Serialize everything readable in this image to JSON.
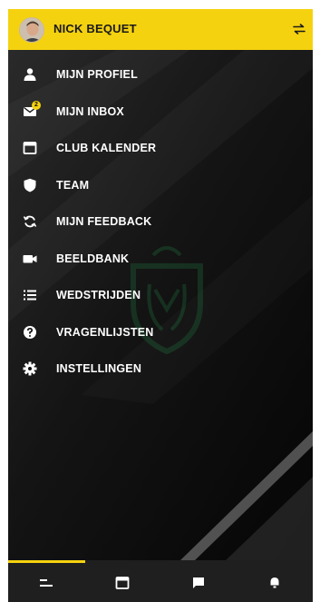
{
  "header": {
    "user_name": "NICK BEQUET",
    "switch_icon": "swap-icon"
  },
  "menu": {
    "items": [
      {
        "label": "MIJN PROFIEL",
        "icon": "person-icon"
      },
      {
        "label": "MIJN INBOX",
        "icon": "mail-icon",
        "badge": "2"
      },
      {
        "label": "CLUB KALENDER",
        "icon": "calendar-icon"
      },
      {
        "label": "TEAM",
        "icon": "shield-icon"
      },
      {
        "label": "MIJN FEEDBACK",
        "icon": "refresh-icon"
      },
      {
        "label": "BEELDBANK",
        "icon": "video-icon"
      },
      {
        "label": "WEDSTRIJDEN",
        "icon": "list-icon"
      },
      {
        "label": "VRAGENLIJSTEN",
        "icon": "question-icon"
      },
      {
        "label": "INSTELLINGEN",
        "icon": "gear-icon"
      }
    ]
  },
  "tabbar": {
    "tabs": [
      {
        "icon": "menu-icon",
        "active": true
      },
      {
        "icon": "calendar-icon",
        "active": false
      },
      {
        "icon": "chat-icon",
        "active": false
      },
      {
        "icon": "bell-icon",
        "active": false
      }
    ]
  },
  "colors": {
    "accent": "#f5d20f",
    "background": "#0f0f0f",
    "tabbar": "#1f1f1f",
    "text": "#ffffff"
  }
}
